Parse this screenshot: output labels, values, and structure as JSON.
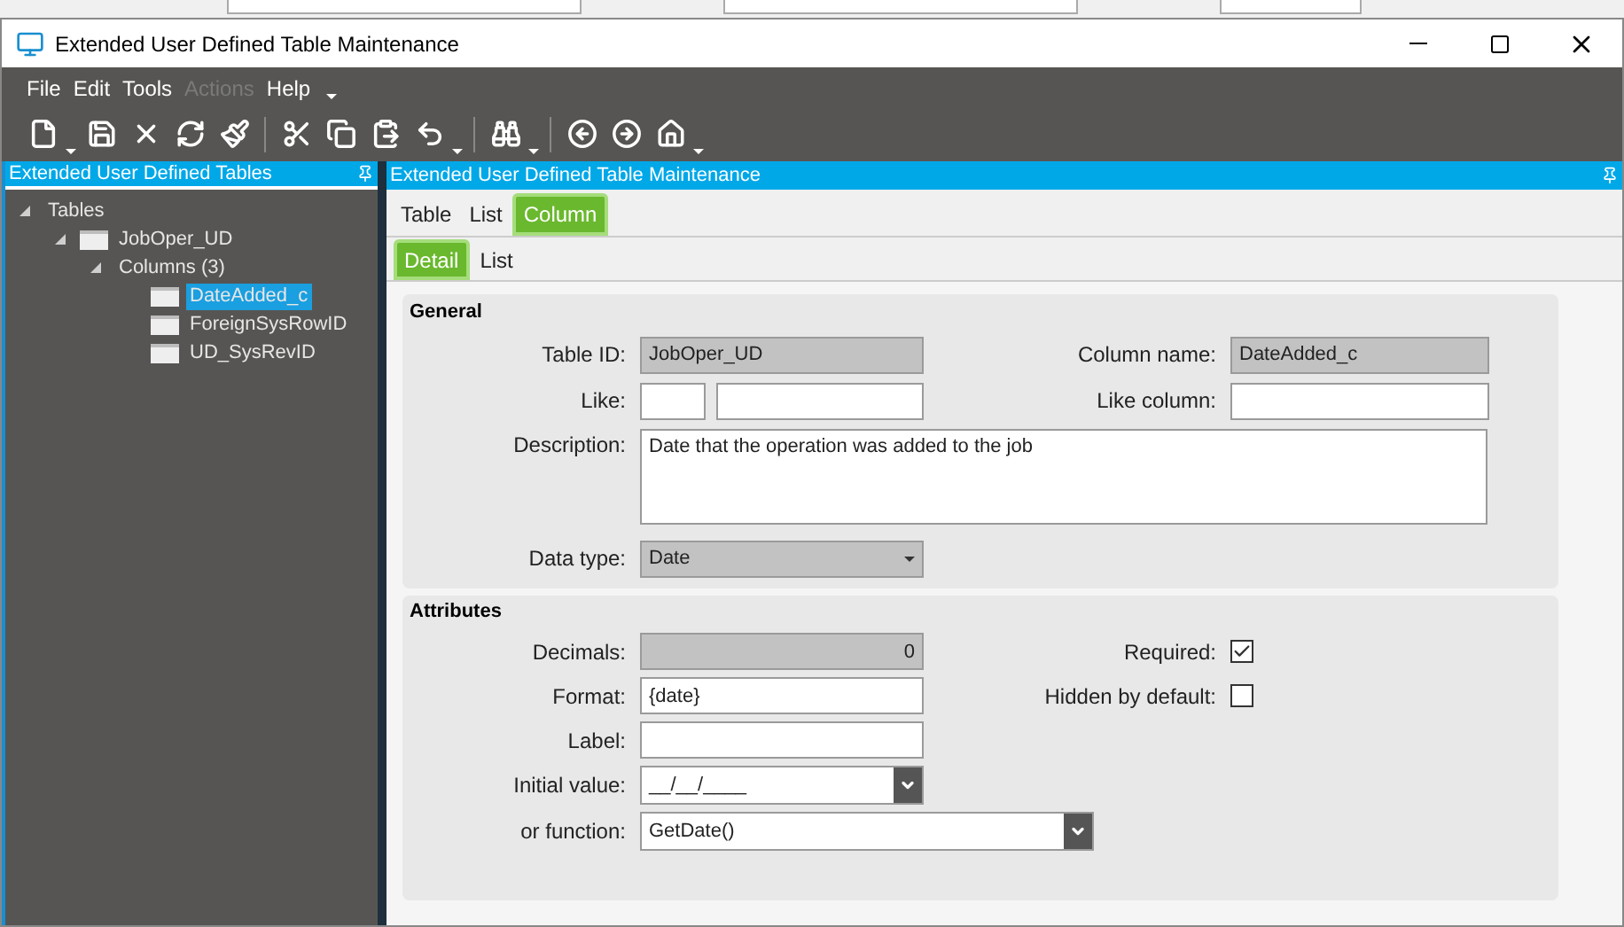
{
  "window": {
    "title": "Extended User Defined Table Maintenance"
  },
  "menu": [
    {
      "label": "File",
      "disabled": false
    },
    {
      "label": "Edit",
      "disabled": false
    },
    {
      "label": "Tools",
      "disabled": false
    },
    {
      "label": "Actions",
      "disabled": true
    },
    {
      "label": "Help",
      "disabled": false
    }
  ],
  "tree_panel": {
    "title": "Extended User Defined Tables",
    "tree": [
      {
        "label": "Tables",
        "expanded": true,
        "selected": false,
        "children": [
          {
            "label": "JobOper_UD",
            "kind": "folder",
            "expanded": true,
            "selected": false,
            "children": [
              {
                "label": "Columns (3)",
                "expanded": true,
                "selected": false,
                "children": [
                  {
                    "label": "DateAdded_c",
                    "kind": "folder",
                    "selected": true
                  },
                  {
                    "label": "ForeignSysRowID",
                    "kind": "folder",
                    "selected": false
                  },
                  {
                    "label": "UD_SysRevID",
                    "kind": "folder",
                    "selected": false
                  }
                ]
              }
            ]
          }
        ]
      }
    ]
  },
  "main_panel": {
    "title": "Extended User Defined Table Maintenance",
    "tabs": [
      {
        "label": "Table",
        "selected": false
      },
      {
        "label": "List",
        "selected": false
      },
      {
        "label": "Column",
        "selected": true
      }
    ],
    "subtabs": [
      {
        "label": "Detail",
        "selected": true
      },
      {
        "label": "List",
        "selected": false
      }
    ],
    "general": {
      "title": "General",
      "table_id": {
        "label": "Table ID:",
        "value": "JobOper_UD"
      },
      "column_name": {
        "label": "Column name:",
        "value": "DateAdded_c"
      },
      "like": {
        "label": "Like:"
      },
      "like_column": {
        "label": "Like column:"
      },
      "description": {
        "label": "Description:",
        "value": "Date that the operation was added to the job"
      },
      "data_type": {
        "label": "Data type:",
        "value": "Date"
      }
    },
    "attributes": {
      "title": "Attributes",
      "decimals": {
        "label": "Decimals:",
        "value": "0"
      },
      "format": {
        "label": "Format:",
        "value": "{date}"
      },
      "label": {
        "label": "Label:"
      },
      "initial_value": {
        "label": "Initial value:",
        "value": "__/__/____"
      },
      "function": {
        "label": "or function:",
        "value": "GetDate()"
      },
      "required": {
        "label": "Required:",
        "checked": true
      },
      "hidden": {
        "label": "Hidden by default:",
        "checked": false
      }
    }
  }
}
